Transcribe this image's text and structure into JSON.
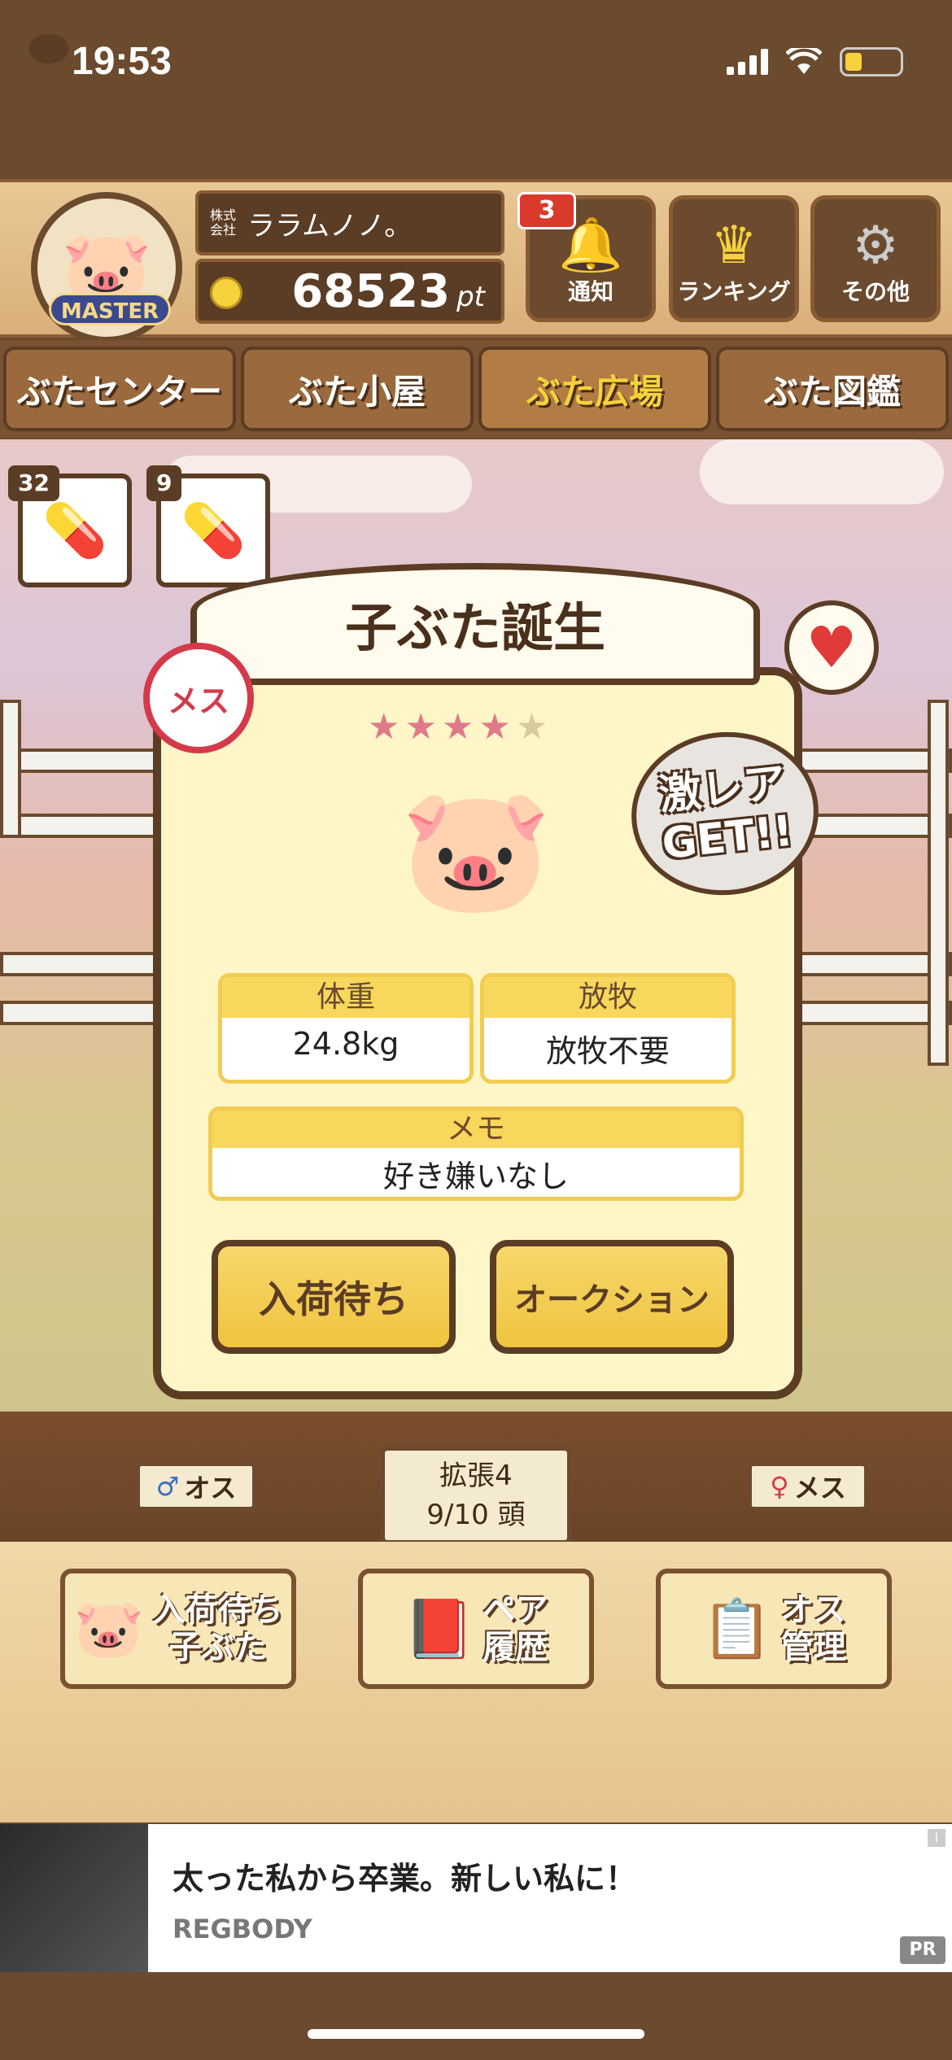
{
  "status_bar": {
    "time": "19:53"
  },
  "header": {
    "company_prefix": "株式会社",
    "company_name": "ララムノノ。",
    "points": "68523",
    "points_unit": "pt",
    "master_label": "MASTER",
    "notification_count": "3",
    "buttons": [
      {
        "label": "通知",
        "icon": "bell-icon"
      },
      {
        "label": "ランキング",
        "icon": "crown-icon"
      },
      {
        "label": "その他",
        "icon": "gear-icon"
      }
    ]
  },
  "nav": {
    "tabs": [
      {
        "label": "ぶたセンター",
        "active": false
      },
      {
        "label": "ぶた小屋",
        "active": false
      },
      {
        "label": "ぶた広場",
        "active": true
      },
      {
        "label": "ぶた図鑑",
        "active": false
      }
    ]
  },
  "items": [
    {
      "count": "32",
      "icon": "female-medicine-icon"
    },
    {
      "count": "9",
      "icon": "male-medicine-icon"
    }
  ],
  "modal": {
    "title": "子ぶた誕生",
    "gender_label": "メス",
    "rating": 4,
    "rating_max": 5,
    "rare_line1": "激レア",
    "rare_line2": "GET!!",
    "weight_label": "体重",
    "weight_value": "24.8kg",
    "grazing_label": "放牧",
    "grazing_value": "放牧不要",
    "memo_label": "メモ",
    "memo_value": "好き嫌いなし",
    "btn_wait": "入荷待ち",
    "btn_auction": "オークション"
  },
  "scene": {
    "male_sign": "オス",
    "female_sign": "メス",
    "expand_label": "拡張4",
    "capacity": "9/10 頭"
  },
  "actions": [
    {
      "label_line1": "入荷待ち",
      "label_line2": "子ぶた",
      "icon": "pig-icon"
    },
    {
      "label_line1": "ペア",
      "label_line2": "履歴",
      "icon": "heart-book-icon"
    },
    {
      "label_line1": "オス",
      "label_line2": "管理",
      "icon": "male-clipboard-icon"
    }
  ],
  "ad": {
    "title": "太った私から卒業。新しい私に！",
    "brand": "REGBODY",
    "pr_badge": "PR",
    "info_icon": "i"
  },
  "colors": {
    "accent_yellow": "#f7d75c",
    "wood_brown": "#5b3c24",
    "female_red": "#d43a4a"
  }
}
